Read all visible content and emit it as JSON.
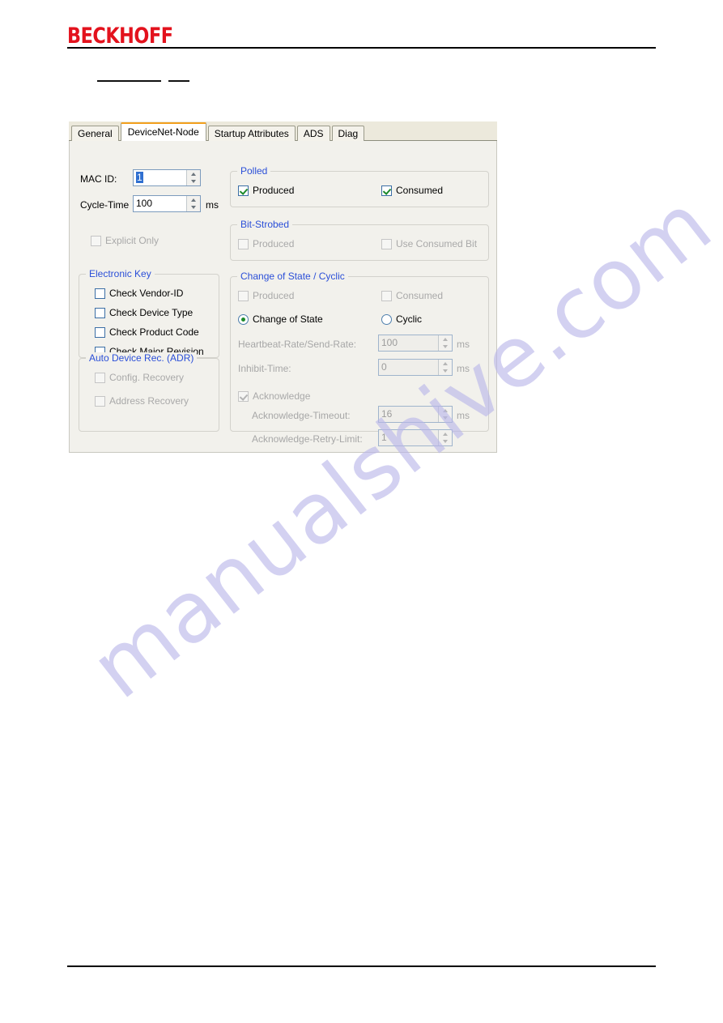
{
  "document": {
    "brand": "BECKHOFF",
    "heading_redacted": true
  },
  "dialog": {
    "tabs": [
      {
        "label": "General",
        "active": false
      },
      {
        "label": "DeviceNet-Node",
        "active": true
      },
      {
        "label": "Startup Attributes",
        "active": false
      },
      {
        "label": "ADS",
        "active": false
      },
      {
        "label": "Diag",
        "active": false
      }
    ],
    "fields": {
      "mac_id_label": "MAC ID:",
      "mac_id_value": "1",
      "cycle_time_label": "Cycle-Time",
      "cycle_time_value": "100",
      "cycle_time_unit": "ms"
    },
    "explicit_only": {
      "label": "Explicit Only",
      "checked": false,
      "enabled": false
    },
    "groups": {
      "polled": {
        "title": "Polled",
        "produced_label": "Produced",
        "produced_checked": true,
        "consumed_label": "Consumed",
        "consumed_checked": true
      },
      "bit_strobed": {
        "title": "Bit-Strobed",
        "produced_label": "Produced",
        "produced_checked": false,
        "use_consumed_bit_label": "Use Consumed Bit",
        "use_consumed_bit_checked": false
      },
      "change_of_state_cyclic": {
        "title": "Change of State / Cyclic",
        "produced_label": "Produced",
        "produced_checked": false,
        "consumed_label": "Consumed",
        "consumed_checked": false,
        "radio_change_of_state_label": "Change of State",
        "radio_change_of_state_selected": true,
        "radio_cyclic_label": "Cyclic",
        "radio_cyclic_selected": false,
        "heartbeat_label": "Heartbeat-Rate/Send-Rate:",
        "heartbeat_value": "100",
        "heartbeat_unit": "ms",
        "inhibit_label": "Inhibit-Time:",
        "inhibit_value": "0",
        "inhibit_unit": "ms",
        "acknowledge_label": "Acknowledge",
        "acknowledge_checked": true,
        "ack_timeout_label": "Acknowledge-Timeout:",
        "ack_timeout_value": "16",
        "ack_timeout_unit": "ms",
        "ack_retry_label": "Acknowledge-Retry-Limit:",
        "ack_retry_value": "1"
      },
      "electronic_key": {
        "title": "Electronic Key",
        "items": [
          {
            "label": "Check Vendor-ID",
            "checked": false
          },
          {
            "label": "Check Device Type",
            "checked": false
          },
          {
            "label": "Check Product Code",
            "checked": false
          },
          {
            "label": "Check Major Revision",
            "checked": false
          }
        ]
      },
      "auto_device_rec": {
        "title": "Auto Device Rec. (ADR)",
        "items": [
          {
            "label": "Config. Recovery",
            "checked": false
          },
          {
            "label": "Address Recovery",
            "checked": false
          }
        ]
      }
    }
  },
  "watermark": {
    "text": "manualshive.com"
  },
  "colors": {
    "brand_red": "#e3121d",
    "group_title_blue": "#2b4fd8",
    "active_tab_accent": "#f2a01e",
    "check_green": "#1d8a2b",
    "panel_background": "#f2f1ec"
  }
}
